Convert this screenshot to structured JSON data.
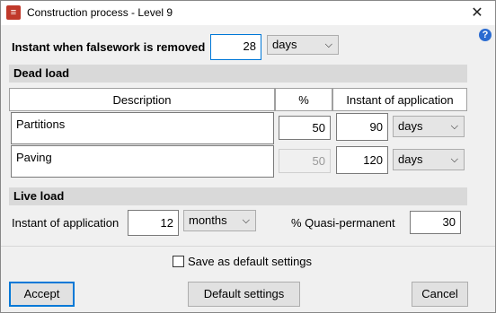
{
  "window": {
    "title": "Construction process - Level 9",
    "close_glyph": "✕",
    "help_glyph": "?"
  },
  "falsework": {
    "label": "Instant when falsework is removed",
    "value": "28",
    "unit": "days"
  },
  "dead_load": {
    "header": "Dead load",
    "columns": {
      "description": "Description",
      "percent": "%",
      "instant": "Instant of application"
    },
    "rows": [
      {
        "description": "Partitions",
        "percent": "50",
        "instant": "90",
        "unit": "days"
      },
      {
        "description": "Paving",
        "percent": "50",
        "instant": "120",
        "unit": "days"
      }
    ]
  },
  "live_load": {
    "header": "Live load",
    "instant_label": "Instant of application",
    "instant_value": "12",
    "instant_unit": "months",
    "quasi_label": "% Quasi-permanent",
    "quasi_value": "30"
  },
  "save_default_label": "Save as default settings",
  "buttons": {
    "accept": "Accept",
    "default_settings": "Default settings",
    "cancel": "Cancel"
  },
  "chevron": "⌵"
}
